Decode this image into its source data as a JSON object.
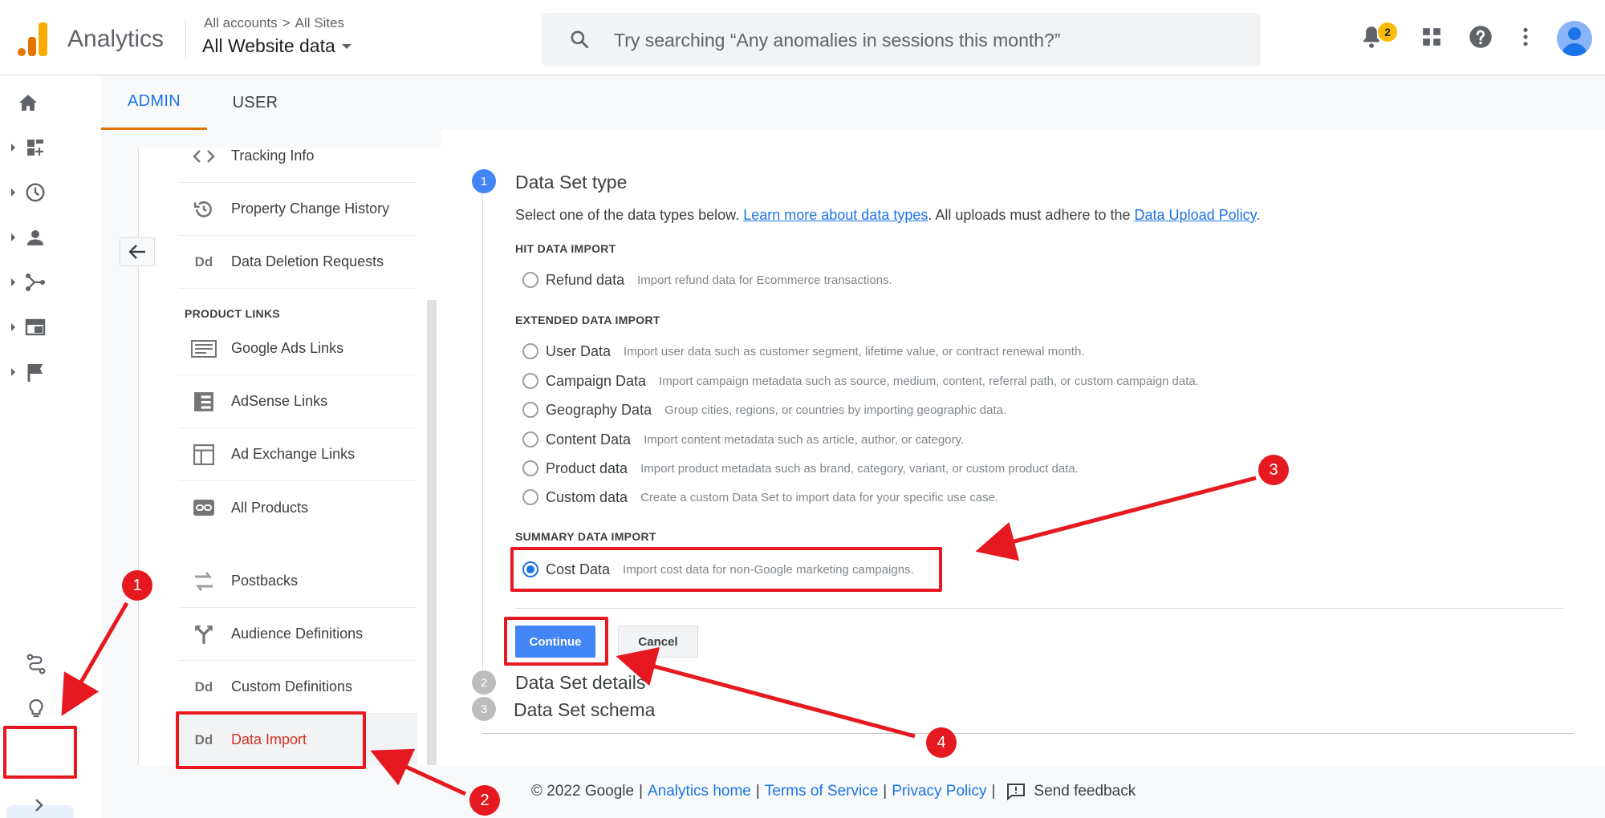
{
  "header": {
    "app_title": "Analytics",
    "breadcrumb_all_accounts": "All accounts",
    "breadcrumb_separator": ">",
    "breadcrumb_all_sites": "All Sites",
    "account_view": "All Website data",
    "search_placeholder": "Try searching “Any anomalies in sessions this month?”",
    "notifications_count": "2",
    "icons": [
      "search-icon",
      "notifications-icon",
      "apps-grid-icon",
      "help-icon",
      "more-vert-icon",
      "account-avatar"
    ]
  },
  "rail": {
    "items": [
      "home-icon",
      "customization-icon",
      "realtime-icon",
      "audience-icon",
      "acquisition-icon",
      "behavior-icon",
      "conversions-icon"
    ],
    "bottom": [
      "attribution-icon",
      "discover-icon",
      "admin-gear-icon",
      "expand-chevron-icon"
    ]
  },
  "tabs": {
    "admin": "ADMIN",
    "user": "USER"
  },
  "property_nav": {
    "items": [
      {
        "label": "Tracking Info",
        "icon": "code-brackets-icon"
      },
      {
        "label": "Property Change History",
        "icon": "history-icon"
      },
      {
        "label": "Data Deletion Requests",
        "icon": "dd-icon"
      }
    ],
    "section_product_links": "PRODUCT LINKS",
    "links": [
      {
        "label": "Google Ads Links",
        "icon": "ads-icon"
      },
      {
        "label": "AdSense Links",
        "icon": "adsense-icon"
      },
      {
        "label": "Ad Exchange Links",
        "icon": "ad-exchange-icon"
      },
      {
        "label": "All Products",
        "icon": "link-icon"
      }
    ],
    "more": [
      {
        "label": "Postbacks",
        "icon": "postbacks-icon"
      },
      {
        "label": "Audience Definitions",
        "icon": "audience-def-icon"
      },
      {
        "label": "Custom Definitions",
        "icon": "dd-icon"
      },
      {
        "label": "Data Import",
        "icon": "dd-icon"
      }
    ],
    "dd_glyph": "Dd"
  },
  "steps": {
    "step1_num": "1",
    "step1_title": "Data Set type",
    "intro_prefix": "Select one of the data types below. ",
    "intro_link1": "Learn more about data types",
    "intro_middle": ". All uploads must adhere to the ",
    "intro_link2": "Data Upload Policy",
    "intro_suffix": ".",
    "hit_label": "HIT DATA IMPORT",
    "hit_options": [
      {
        "label": "Refund data",
        "desc": "Import refund data for Ecommerce transactions."
      }
    ],
    "extended_label": "EXTENDED DATA IMPORT",
    "extended_options": [
      {
        "label": "User Data",
        "desc": "Import user data such as customer segment, lifetime value, or contract renewal month."
      },
      {
        "label": "Campaign Data",
        "desc": "Import campaign metadata such as source, medium, content, referral path, or custom campaign data."
      },
      {
        "label": "Geography Data",
        "desc": "Group cities, regions, or countries by importing geographic data."
      },
      {
        "label": "Content Data",
        "desc": "Import content metadata such as article, author, or category."
      },
      {
        "label": "Product data",
        "desc": "Import product metadata such as brand, category, variant, or custom product data."
      },
      {
        "label": "Custom data",
        "desc": "Create a custom Data Set to import data for your specific use case."
      }
    ],
    "summary_label": "SUMMARY DATA IMPORT",
    "summary_options": [
      {
        "label": "Cost Data",
        "desc": "Import cost data for non-Google marketing campaigns.",
        "selected": true
      }
    ],
    "continue_label": "Continue",
    "cancel_label": "Cancel",
    "step2_num": "2",
    "step2_title": "Data Set details",
    "step3_num": "3",
    "step3_title": "Data Set schema"
  },
  "footer": {
    "copyright": "© 2022 Google",
    "sep": "|",
    "analytics_home": "Analytics home",
    "terms": "Terms of Service",
    "privacy": "Privacy Policy",
    "feedback": "Send feedback"
  },
  "annotations": {
    "n1": "1",
    "n2": "2",
    "n3": "3",
    "n4": "4"
  },
  "colors": {
    "accent": "#1a73e8",
    "annotation_red": "#e5191f",
    "active_tab_underline": "#e37400",
    "active_nav_text": "#d93025"
  }
}
